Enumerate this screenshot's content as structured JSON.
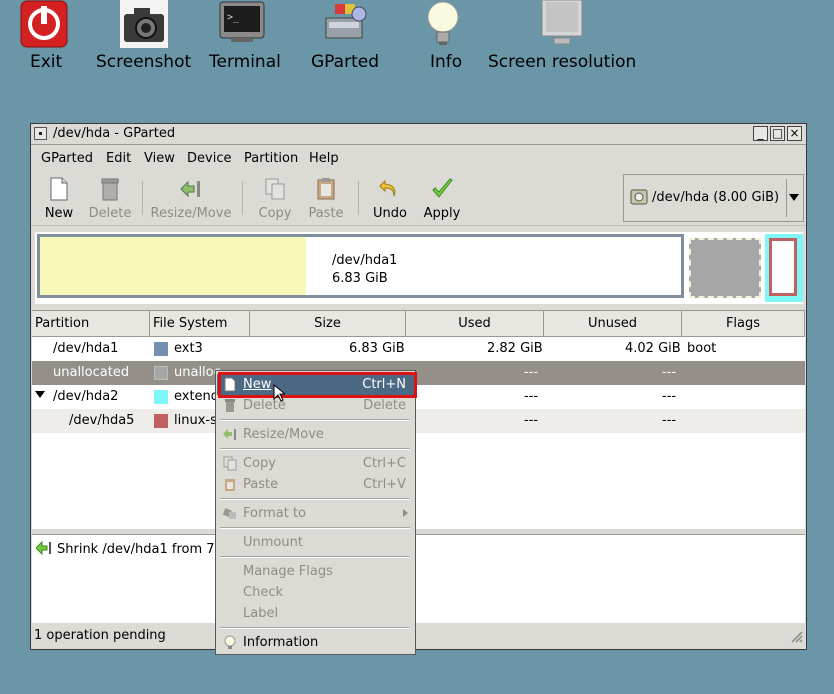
{
  "desktop": {
    "icons": [
      {
        "label": "Exit"
      },
      {
        "label": "Screenshot"
      },
      {
        "label": "Terminal"
      },
      {
        "label": "GParted"
      },
      {
        "label": "Info"
      },
      {
        "label": "Screen resolution"
      }
    ]
  },
  "window": {
    "title": "/dev/hda - GParted",
    "menus": [
      "GParted",
      "Edit",
      "View",
      "Device",
      "Partition",
      "Help"
    ],
    "toolbar": {
      "new": "New",
      "delete": "Delete",
      "resize": "Resize/Move",
      "copy": "Copy",
      "paste": "Paste",
      "undo": "Undo",
      "apply": "Apply"
    },
    "device_selector": "/dev/hda  (8.00 GiB)",
    "visual": {
      "name": "/dev/hda1",
      "size": "6.83 GiB"
    },
    "table": {
      "headers": [
        "Partition",
        "File System",
        "Size",
        "Used",
        "Unused",
        "Flags"
      ],
      "rows": [
        {
          "partition": "/dev/hda1",
          "fs": "ext3",
          "size": "6.83 GiB",
          "used": "2.82 GiB",
          "unused": "4.02 GiB",
          "flags": "boot",
          "color": "#7590ae"
        },
        {
          "partition": "unallocated",
          "fs": "unalloc",
          "size": "",
          "used": "---",
          "unused": "---",
          "flags": "",
          "color": "#a6a6a6"
        },
        {
          "partition": "/dev/hda2",
          "fs": "extend",
          "size": "",
          "used": "---",
          "unused": "---",
          "flags": "",
          "color": "#7ff7f7"
        },
        {
          "partition": "/dev/hda5",
          "fs": "linux-s",
          "size": "",
          "used": "---",
          "unused": "---",
          "flags": "",
          "color": "#c06060"
        }
      ]
    },
    "log": "Shrink /dev/hda1 from 7.",
    "status": "1 operation pending"
  },
  "context_menu": {
    "items": [
      {
        "label": "New",
        "shortcut": "Ctrl+N"
      },
      {
        "label": "Delete",
        "shortcut": "Delete"
      },
      {
        "label": "Resize/Move",
        "shortcut": ""
      },
      {
        "label": "Copy",
        "shortcut": "Ctrl+C"
      },
      {
        "label": "Paste",
        "shortcut": "Ctrl+V"
      },
      {
        "label": "Format to",
        "shortcut": ""
      },
      {
        "label": "Unmount",
        "shortcut": ""
      },
      {
        "label": "Manage Flags",
        "shortcut": ""
      },
      {
        "label": "Check",
        "shortcut": ""
      },
      {
        "label": "Label",
        "shortcut": ""
      },
      {
        "label": "Information",
        "shortcut": ""
      }
    ]
  },
  "colors": {
    "desktop_bg": "#6a96a8",
    "highlight": "#4b6983",
    "annotation_box": "#dd1111"
  }
}
